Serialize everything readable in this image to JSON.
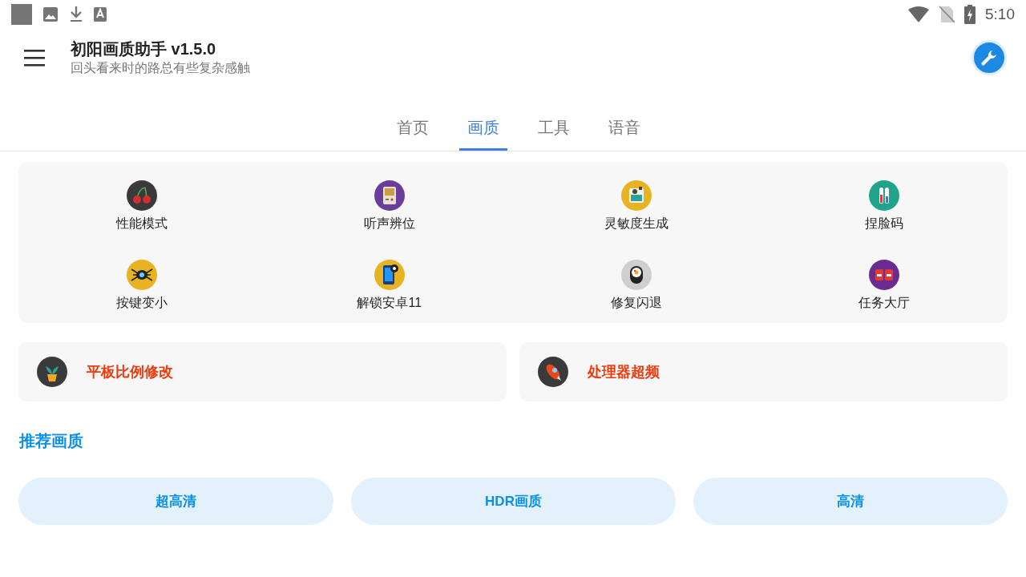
{
  "status_bar": {
    "time": "5:10"
  },
  "toolbar": {
    "title": "初阳画质助手 v1.5.0",
    "subtitle": "回头看来时的路总有些复杂感触"
  },
  "tabs": [
    {
      "label": "首页",
      "selected": false
    },
    {
      "label": "画质",
      "selected": true
    },
    {
      "label": "工具",
      "selected": false
    },
    {
      "label": "语音",
      "selected": false
    }
  ],
  "features": [
    {
      "label": "性能模式"
    },
    {
      "label": "听声辨位"
    },
    {
      "label": "灵敏度生成"
    },
    {
      "label": "捏脸码"
    },
    {
      "label": "按键变小"
    },
    {
      "label": "解锁安卓11"
    },
    {
      "label": "修复闪退"
    },
    {
      "label": "任务大厅"
    }
  ],
  "cards": [
    {
      "label": "平板比例修改"
    },
    {
      "label": "处理器超频"
    }
  ],
  "section_title": "推荐画质",
  "quality_buttons": [
    {
      "label": "超高清"
    },
    {
      "label": "HDR画质"
    },
    {
      "label": "高清"
    }
  ]
}
